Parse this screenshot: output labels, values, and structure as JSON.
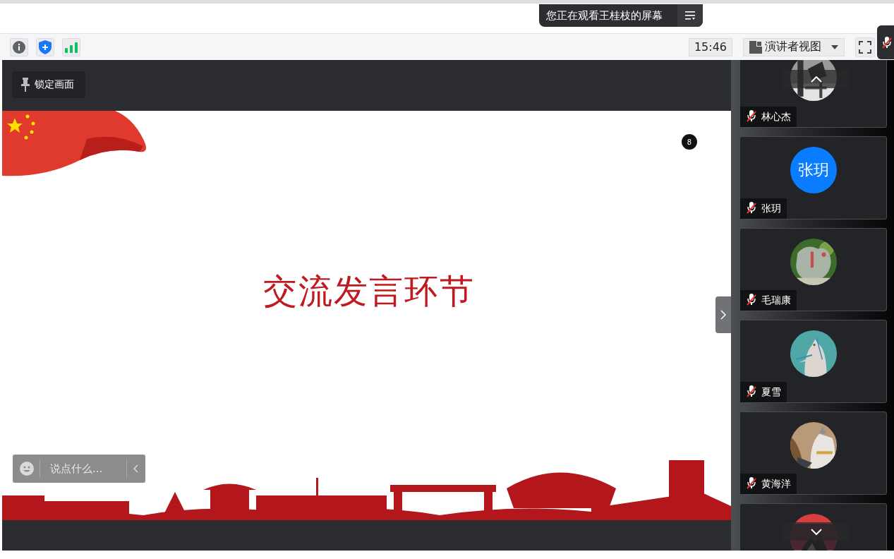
{
  "banner": {
    "text": "您正在观看王桂枝的屏幕"
  },
  "lock_button": {
    "label": "锁定画面"
  },
  "toolbar": {
    "time": "15:46",
    "view_mode": "演讲者视图"
  },
  "slide": {
    "title": "交流发言环节",
    "badge": "8"
  },
  "chat": {
    "placeholder": "说点什么..."
  },
  "participants": [
    {
      "name": "林心杰",
      "muted": true,
      "avatar": {
        "kind": "picture"
      }
    },
    {
      "name": "张玥",
      "muted": true,
      "avatar": {
        "kind": "initials",
        "text": "张玥"
      }
    },
    {
      "name": "毛瑞康",
      "muted": true,
      "avatar": {
        "kind": "picture"
      }
    },
    {
      "name": "夏雪",
      "muted": true,
      "avatar": {
        "kind": "picture"
      }
    },
    {
      "name": "黄海洋",
      "muted": true,
      "avatar": {
        "kind": "picture"
      }
    },
    {
      "avatar": {
        "kind": "picture"
      }
    }
  ]
}
